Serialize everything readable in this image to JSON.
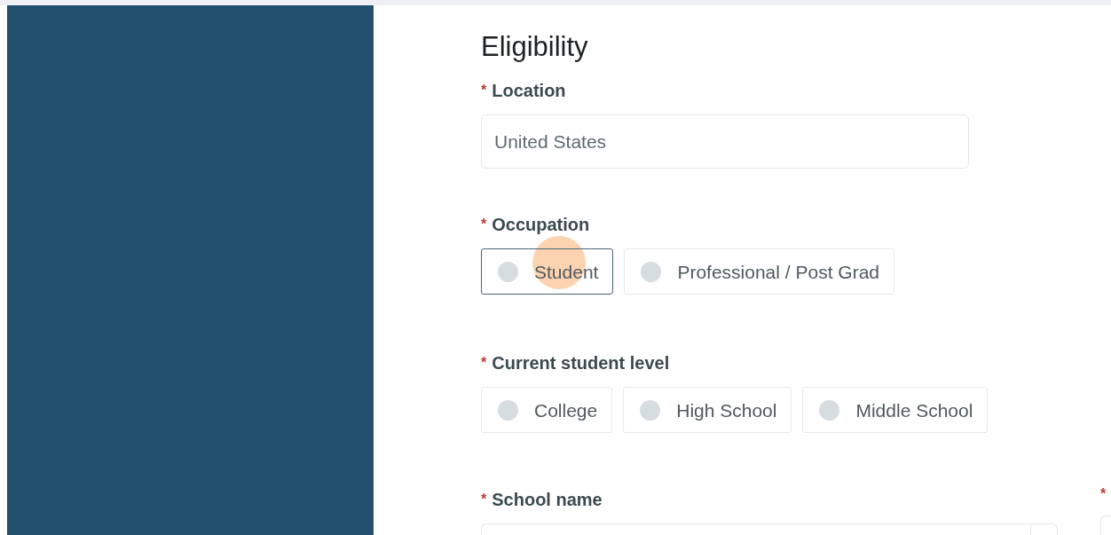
{
  "form": {
    "title": "Eligibility",
    "location": {
      "label": "Location",
      "required": true,
      "required_mark": "*",
      "value": "United States"
    },
    "occupation": {
      "label": "Occupation",
      "required": true,
      "required_mark": "*",
      "options": [
        {
          "label": "Student",
          "selected": false,
          "focused": true
        },
        {
          "label": "Professional / Post Grad",
          "selected": false,
          "focused": false
        }
      ]
    },
    "student_level": {
      "label": "Current student level",
      "required": true,
      "required_mark": "*",
      "options": [
        {
          "label": "College",
          "selected": false,
          "focused": false
        },
        {
          "label": "High School",
          "selected": false,
          "focused": false
        },
        {
          "label": "Middle School",
          "selected": false,
          "focused": false
        }
      ]
    },
    "school_name": {
      "label": "School name",
      "required": true,
      "required_mark": "*"
    },
    "column_2_field": {
      "required": true,
      "required_mark": "*"
    }
  }
}
